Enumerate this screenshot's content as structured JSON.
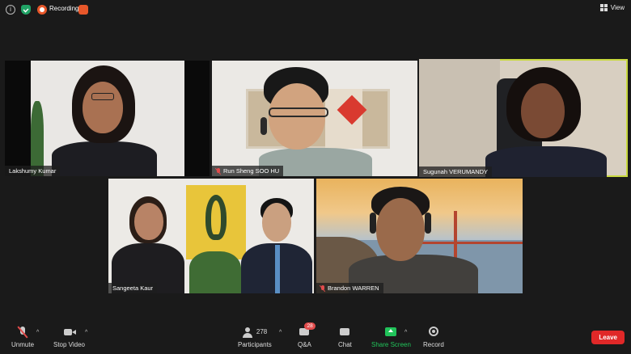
{
  "topbar": {
    "recording_label": "Recording",
    "view_label": "View"
  },
  "participants": [
    {
      "name": "Lakshumy Kumar",
      "muted": false
    },
    {
      "name": "Run Sheng SOO HU",
      "muted": true
    },
    {
      "name": "Sugunah VERUMANDY",
      "muted": false,
      "active_speaker": true
    },
    {
      "name": "Sangeeta Kaur",
      "muted": false
    },
    {
      "name": "Brandon WARREN",
      "muted": true
    }
  ],
  "toolbar": {
    "unmute_label": "Unmute",
    "stop_video_label": "Stop Video",
    "participants_label": "Participants",
    "participants_count": "278",
    "qa_label": "Q&A",
    "qa_badge": "28",
    "chat_label": "Chat",
    "share_screen_label": "Share Screen",
    "record_label": "Record",
    "leave_label": "Leave"
  },
  "colors": {
    "background": "#1a1a1a",
    "active_speaker_border": "#c9d93f",
    "share_screen": "#21c35a",
    "leave": "#e02828",
    "mute_red": "#e24c4c"
  }
}
